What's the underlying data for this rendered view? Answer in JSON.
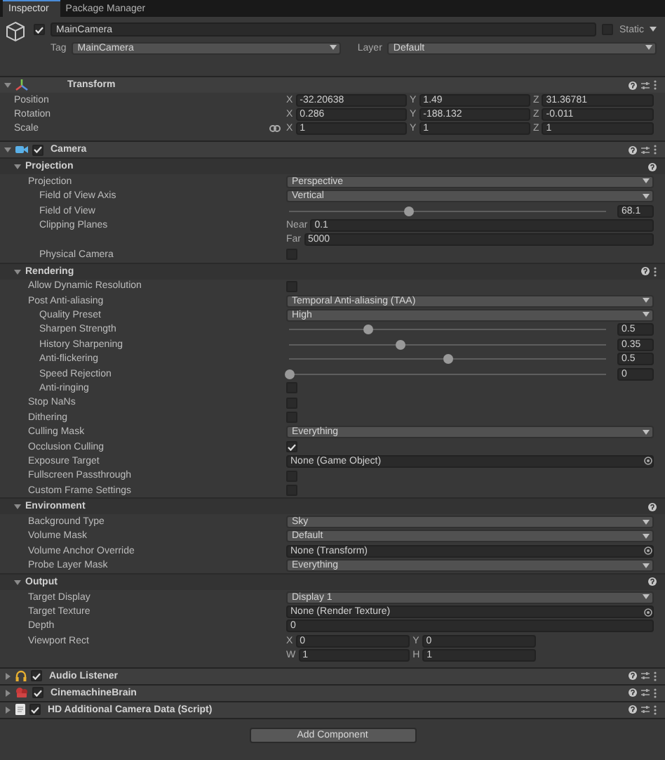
{
  "tabs": [
    {
      "label": "Inspector",
      "selected": true
    },
    {
      "label": "Package Manager",
      "selected": false
    }
  ],
  "object": {
    "name": "MainCamera",
    "active": true,
    "static_label": "Static",
    "static": false,
    "tag_label": "Tag",
    "tag": "MainCamera",
    "layer_label": "Layer",
    "layer": "Default"
  },
  "components": [
    {
      "name": "Transform",
      "kind": "transform",
      "expanded": true,
      "fields": [
        {
          "kind": "vector",
          "label": "Position",
          "linked": false,
          "parts": [
            {
              "axis": "X",
              "value": "-32.20638"
            },
            {
              "axis": "Y",
              "value": "1.49"
            },
            {
              "axis": "Z",
              "value": "31.36781"
            }
          ]
        },
        {
          "kind": "vector",
          "label": "Rotation",
          "linked": false,
          "parts": [
            {
              "axis": "X",
              "value": "0.286"
            },
            {
              "axis": "Y",
              "value": "-188.132"
            },
            {
              "axis": "Z",
              "value": "-0.011"
            }
          ]
        },
        {
          "kind": "vector",
          "label": "Scale",
          "linked": true,
          "parts": [
            {
              "axis": "X",
              "value": "1"
            },
            {
              "axis": "Y",
              "value": "1"
            },
            {
              "axis": "Z",
              "value": "1"
            }
          ]
        }
      ]
    },
    {
      "name": "Camera",
      "kind": "camera",
      "enabled": true,
      "expanded": true,
      "sections": [
        {
          "title": "Projection",
          "expanded": true,
          "menu": false,
          "fields": [
            {
              "kind": "dropdown",
              "label": "Projection",
              "value": "Perspective",
              "children": [
                {
                  "kind": "dropdown",
                  "label": "Field of View Axis",
                  "value": "Vertical"
                },
                {
                  "kind": "slider",
                  "label": "Field of View",
                  "level": 0.38,
                  "reading": "68.1"
                },
                {
                  "kind": "pair",
                  "label": "Clipping Planes",
                  "parts": [
                    {
                      "axis": "Near",
                      "value": "0.1"
                    },
                    {
                      "axis": "Far",
                      "value": "5000"
                    }
                  ]
                },
                {
                  "kind": "checkbox",
                  "label": "Physical Camera",
                  "checked": false
                }
              ]
            }
          ]
        },
        {
          "title": "Rendering",
          "expanded": true,
          "menu": true,
          "fields": [
            {
              "kind": "checkbox",
              "label": "Allow Dynamic Resolution",
              "checked": false
            },
            {
              "kind": "dropdown",
              "label": "Post Anti-aliasing",
              "value": "Temporal Anti-aliasing (TAA)",
              "children": [
                {
                  "kind": "dropdown",
                  "label": "Quality Preset",
                  "value": "High"
                },
                {
                  "kind": "slider",
                  "label": "Sharpen Strength",
                  "level": 0.25,
                  "reading": "0.5"
                },
                {
                  "kind": "slider",
                  "label": "History Sharpening",
                  "level": 0.35,
                  "reading": "0.35"
                },
                {
                  "kind": "slider",
                  "label": "Anti-flickering",
                  "level": 0.5,
                  "reading": "0.5"
                },
                {
                  "kind": "slider",
                  "label": "Speed Rejection",
                  "level": 0,
                  "reading": "0"
                },
                {
                  "kind": "checkbox",
                  "label": "Anti-ringing",
                  "checked": false
                }
              ]
            },
            {
              "kind": "checkbox",
              "label": "Stop NaNs",
              "checked": false
            },
            {
              "kind": "checkbox",
              "label": "Dithering",
              "checked": false
            },
            {
              "kind": "dropdown",
              "label": "Culling Mask",
              "value": "Everything"
            },
            {
              "kind": "checkbox",
              "label": "Occlusion Culling",
              "checked": true
            },
            {
              "kind": "object",
              "label": "Exposure Target",
              "value": "None (Game Object)"
            },
            {
              "kind": "checkbox",
              "label": "Fullscreen Passthrough",
              "checked": false
            },
            {
              "kind": "checkbox",
              "label": "Custom Frame Settings",
              "checked": false
            }
          ]
        },
        {
          "title": "Environment",
          "expanded": true,
          "menu": false,
          "fields": [
            {
              "kind": "dropdown",
              "label": "Background Type",
              "value": "Sky"
            },
            {
              "kind": "dropdown",
              "label": "Volume Mask",
              "value": "Default"
            },
            {
              "kind": "object",
              "label": "Volume Anchor Override",
              "value": "None (Transform)"
            },
            {
              "kind": "dropdown",
              "label": "Probe Layer Mask",
              "value": "Everything"
            }
          ]
        },
        {
          "title": "Output",
          "expanded": true,
          "menu": false,
          "fields": [
            {
              "kind": "dropdown",
              "label": "Target Display",
              "value": "Display 1"
            },
            {
              "kind": "object",
              "label": "Target Texture",
              "value": "None (Render Texture)"
            },
            {
              "kind": "text",
              "label": "Depth",
              "value": "0"
            },
            {
              "kind": "rect",
              "label": "Viewport Rect",
              "parts": [
                {
                  "axis": "X",
                  "value": "0"
                },
                {
                  "axis": "Y",
                  "value": "0"
                },
                {
                  "axis": "W",
                  "value": "1"
                },
                {
                  "axis": "H",
                  "value": "1"
                }
              ]
            }
          ]
        }
      ]
    },
    {
      "name": "Audio Listener",
      "kind": "listener",
      "enabled": true,
      "expanded": false
    },
    {
      "name": "CinemachineBrain",
      "kind": "brain",
      "enabled": true,
      "expanded": false
    },
    {
      "name": "HD Additional Camera Data (Script)",
      "kind": "script",
      "enabled": true,
      "expanded": false
    }
  ],
  "add_component": "Add Component"
}
